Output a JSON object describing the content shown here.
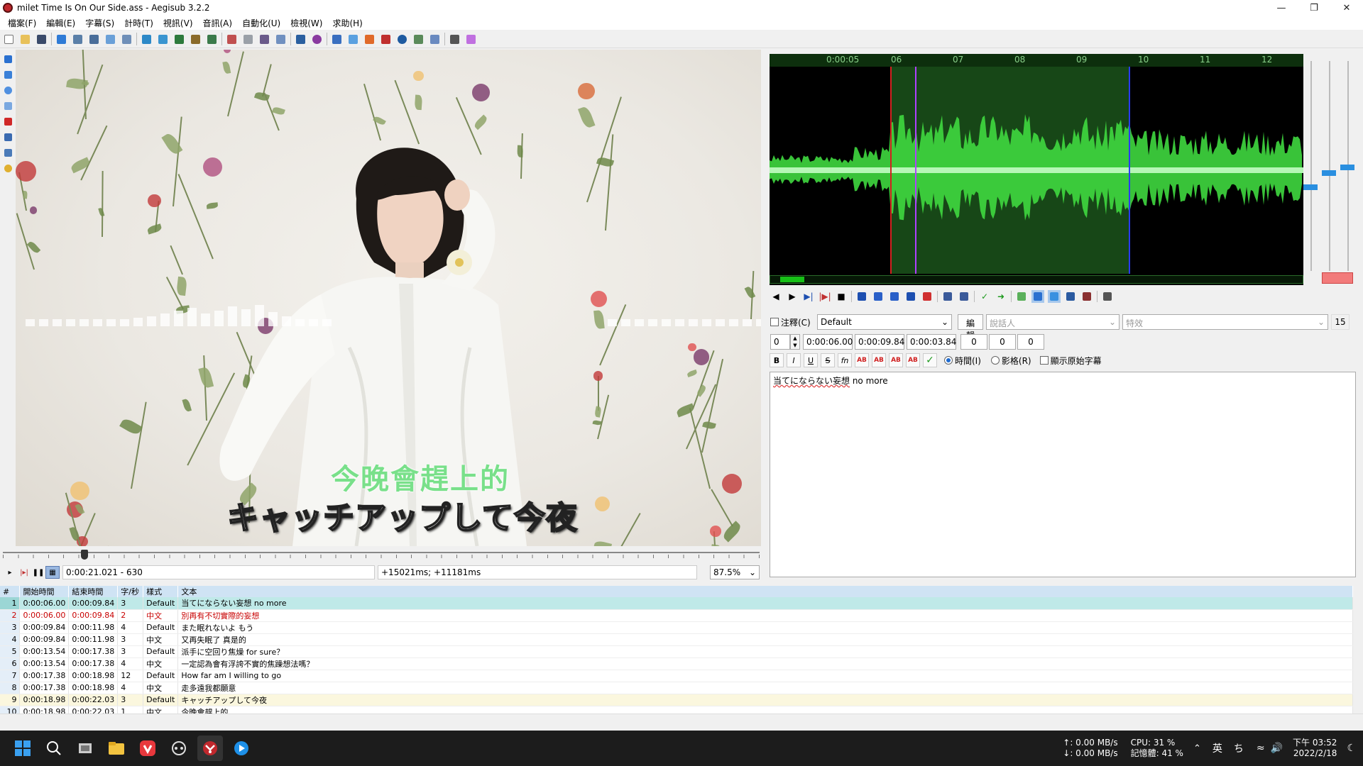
{
  "window": {
    "title": "milet Time Is On Our Side.ass - Aegisub 3.2.2",
    "controls": [
      "minimize",
      "restore",
      "close"
    ]
  },
  "menu": [
    "檔案(F)",
    "編輯(E)",
    "字幕(S)",
    "計時(T)",
    "視訊(V)",
    "音訊(A)",
    "自動化(U)",
    "檢視(W)",
    "求助(H)"
  ],
  "video": {
    "subtitle_cn": "今晚會趕上的",
    "subtitle_jp": "キャッチアップして今夜",
    "time_field": "0:00:21.021 - 630",
    "offset_field": "+15021ms; +11181ms",
    "zoom": "87.5%"
  },
  "audio": {
    "ruler_labels": [
      "0:00:05",
      "06",
      "07",
      "08",
      "09",
      "10",
      "11",
      "12"
    ],
    "accent_colors": {
      "selection": "#174717",
      "wave": "#3fd83f",
      "start_line": "#d42020",
      "end_line": "#2a3aff",
      "play_line": "#b040ff"
    }
  },
  "edit": {
    "comment_label": "注釋(C)",
    "style": "Default",
    "edit_button": "編輯",
    "actor_placeholder": "說話人",
    "effect_placeholder": "特效",
    "char_count": "15",
    "layer": "0",
    "start": "0:00:06.00",
    "end": "0:00:09.84",
    "duration": "0:00:03.84",
    "margin_l": "0",
    "margin_r": "0",
    "margin_v": "0",
    "format_buttons": [
      "B",
      "I",
      "U",
      "S",
      "fn",
      "AB",
      "AB",
      "AB",
      "AB"
    ],
    "radio_time": "時間(I)",
    "radio_frame": "影格(R)",
    "show_original": "顯示原始字幕",
    "text_jp": "当てにならない妄想",
    "text_en": " no more"
  },
  "grid": {
    "headers": [
      "#",
      "開始時間",
      "結束時間",
      "字/秒",
      "樣式",
      "文本"
    ],
    "rows": [
      [
        "1",
        "0:00:06.00",
        "0:00:09.84",
        "3",
        "Default",
        "当てにならない妄想 no more"
      ],
      [
        "2",
        "0:00:06.00",
        "0:00:09.84",
        "2",
        "中文",
        "別再有不切實際的妄想"
      ],
      [
        "3",
        "0:00:09.84",
        "0:00:11.98",
        "4",
        "Default",
        "また眠れないよ もう"
      ],
      [
        "4",
        "0:00:09.84",
        "0:00:11.98",
        "3",
        "中文",
        "又再失眠了 真是的"
      ],
      [
        "5",
        "0:00:13.54",
        "0:00:17.38",
        "3",
        "Default",
        "派手に空回り焦燥 for sure？"
      ],
      [
        "6",
        "0:00:13.54",
        "0:00:17.38",
        "4",
        "中文",
        "一定認為會有浮誇不實的焦躁想法嗎？"
      ],
      [
        "7",
        "0:00:17.38",
        "0:00:18.98",
        "12",
        "Default",
        "How far am I willing to go"
      ],
      [
        "8",
        "0:00:17.38",
        "0:00:18.98",
        "4",
        "中文",
        "走多遠我都願意"
      ],
      [
        "9",
        "0:00:18.98",
        "0:00:22.03",
        "3",
        "Default",
        "キャッチアップして今夜"
      ],
      [
        "10",
        "0:00:18.98",
        "0:00:22.03",
        "1",
        "中文",
        "今晚會趕上的"
      ]
    ]
  },
  "taskbar": {
    "net_up": "↑: 0.00 MB/s",
    "net_down": "↓: 0.00 MB/s",
    "cpu": "CPU: 31 %",
    "mem": "記憶體: 41 %",
    "ime": "英",
    "time": "下午 03:52",
    "date": "2022/2/18"
  }
}
